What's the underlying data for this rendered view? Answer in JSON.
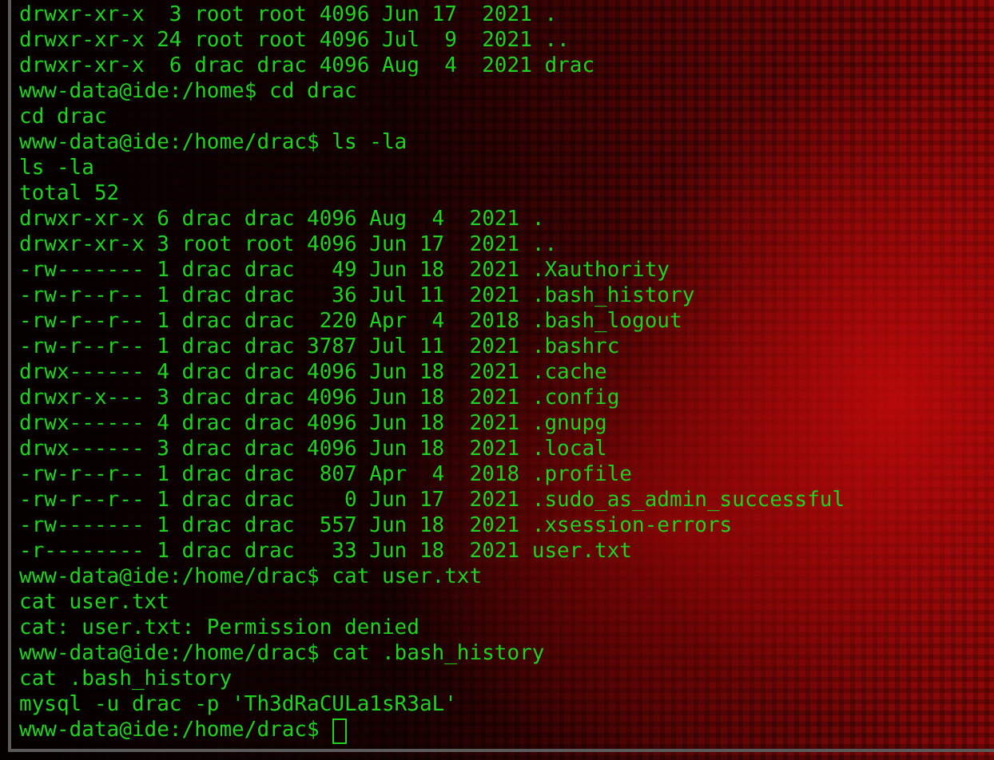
{
  "terminal": {
    "lines": [
      {
        "kind": "output",
        "text": "drwxr-xr-x  3 root root 4096 Jun 17  2021 ."
      },
      {
        "kind": "output",
        "text": "drwxr-xr-x 24 root root 4096 Jul  9  2021 .."
      },
      {
        "kind": "output",
        "text": "drwxr-xr-x  6 drac drac 4096 Aug  4  2021 drac"
      },
      {
        "kind": "prompt",
        "prompt": "www-data@ide:/home$",
        "command": "cd drac"
      },
      {
        "kind": "output",
        "text": "cd drac"
      },
      {
        "kind": "prompt",
        "prompt": "www-data@ide:/home/drac$",
        "command": "ls -la"
      },
      {
        "kind": "output",
        "text": "ls -la"
      },
      {
        "kind": "output",
        "text": "total 52"
      },
      {
        "kind": "output",
        "text": "drwxr-xr-x 6 drac drac 4096 Aug  4  2021 ."
      },
      {
        "kind": "output",
        "text": "drwxr-xr-x 3 root root 4096 Jun 17  2021 .."
      },
      {
        "kind": "output",
        "text": "-rw------- 1 drac drac   49 Jun 18  2021 .Xauthority"
      },
      {
        "kind": "output",
        "text": "-rw-r--r-- 1 drac drac   36 Jul 11  2021 .bash_history"
      },
      {
        "kind": "output",
        "text": "-rw-r--r-- 1 drac drac  220 Apr  4  2018 .bash_logout"
      },
      {
        "kind": "output",
        "text": "-rw-r--r-- 1 drac drac 3787 Jul 11  2021 .bashrc"
      },
      {
        "kind": "output",
        "text": "drwx------ 4 drac drac 4096 Jun 18  2021 .cache"
      },
      {
        "kind": "output",
        "text": "drwxr-x--- 3 drac drac 4096 Jun 18  2021 .config"
      },
      {
        "kind": "output",
        "text": "drwx------ 4 drac drac 4096 Jun 18  2021 .gnupg"
      },
      {
        "kind": "output",
        "text": "drwx------ 3 drac drac 4096 Jun 18  2021 .local"
      },
      {
        "kind": "output",
        "text": "-rw-r--r-- 1 drac drac  807 Apr  4  2018 .profile"
      },
      {
        "kind": "output",
        "text": "-rw-r--r-- 1 drac drac    0 Jun 17  2021 .sudo_as_admin_successful"
      },
      {
        "kind": "output",
        "text": "-rw------- 1 drac drac  557 Jun 18  2021 .xsession-errors"
      },
      {
        "kind": "output",
        "text": "-r-------- 1 drac drac   33 Jun 18  2021 user.txt"
      },
      {
        "kind": "prompt",
        "prompt": "www-data@ide:/home/drac$",
        "command": "cat user.txt"
      },
      {
        "kind": "output",
        "text": "cat user.txt"
      },
      {
        "kind": "output",
        "text": "cat: user.txt: Permission denied"
      },
      {
        "kind": "prompt",
        "prompt": "www-data@ide:/home/drac$",
        "command": "cat .bash_history"
      },
      {
        "kind": "output",
        "text": "cat .bash_history"
      },
      {
        "kind": "output",
        "text": "mysql -u drac -p 'Th3dRaCULa1sR3aL'"
      },
      {
        "kind": "input",
        "prompt": "www-data@ide:/home/drac$"
      }
    ]
  }
}
